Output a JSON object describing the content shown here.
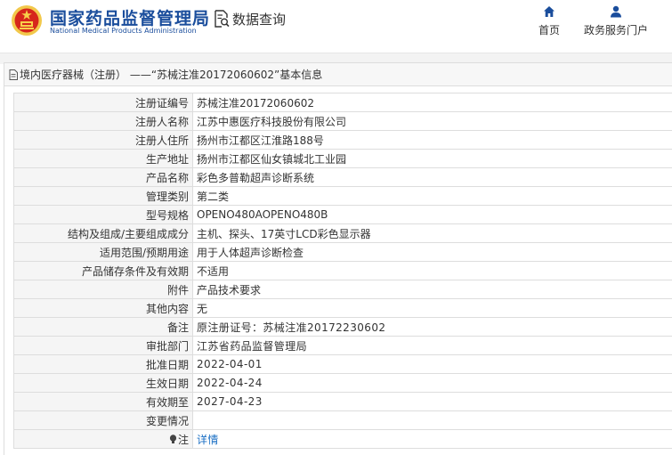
{
  "header": {
    "site_title": "国家药品监督管理局",
    "site_subtitle": "National Medical Products Administration",
    "query_label": "数据查询",
    "nav": {
      "home_label": "首页",
      "gov_services_label": "政务服务门户"
    }
  },
  "panel": {
    "title": "境内医疗器械（注册） ——“苏械注准20172060602”基本信息"
  },
  "rows": [
    {
      "key": "注册证编号",
      "value": "苏械注准20172060602"
    },
    {
      "key": "注册人名称",
      "value": "江苏中惠医疗科技股份有限公司"
    },
    {
      "key": "注册人住所",
      "value": "扬州市江都区江淮路188号"
    },
    {
      "key": "生产地址",
      "value": "扬州市江都区仙女镇城北工业园"
    },
    {
      "key": "产品名称",
      "value": "彩色多普勒超声诊断系统"
    },
    {
      "key": "管理类别",
      "value": "第二类"
    },
    {
      "key": "型号规格",
      "value": "OPENO480AOPENO480B"
    },
    {
      "key": "结构及组成/主要组成成分",
      "value": "主机、探头、17英寸LCD彩色显示器"
    },
    {
      "key": "适用范围/预期用途",
      "value": "用于人体超声诊断检查"
    },
    {
      "key": "产品储存条件及有效期",
      "value": "不适用"
    },
    {
      "key": "附件",
      "value": "产品技术要求"
    },
    {
      "key": "其他内容",
      "value": "无"
    },
    {
      "key": "备注",
      "value": "原注册证号：苏械注准20172230602"
    },
    {
      "key": "审批部门",
      "value": "江苏省药品监督管理局"
    },
    {
      "key": "批准日期",
      "value": "2022-04-01"
    },
    {
      "key": "生效日期",
      "value": "2022-04-24"
    },
    {
      "key": "有效期至",
      "value": "2027-04-23"
    },
    {
      "key": "变更情况",
      "value": ""
    }
  ],
  "note_row": {
    "key": "注",
    "link_label": "详情"
  },
  "icons": {
    "logo": "national-emblem-icon",
    "query": "search-document-icon",
    "home": "home-icon",
    "gov": "user-icon",
    "panel": "document-icon",
    "note": "bulb-icon"
  },
  "colors": {
    "brand": "#1a4d9c",
    "link": "#1a6fc4",
    "border": "#dddddd",
    "key_bg": "#f5f5f5"
  }
}
